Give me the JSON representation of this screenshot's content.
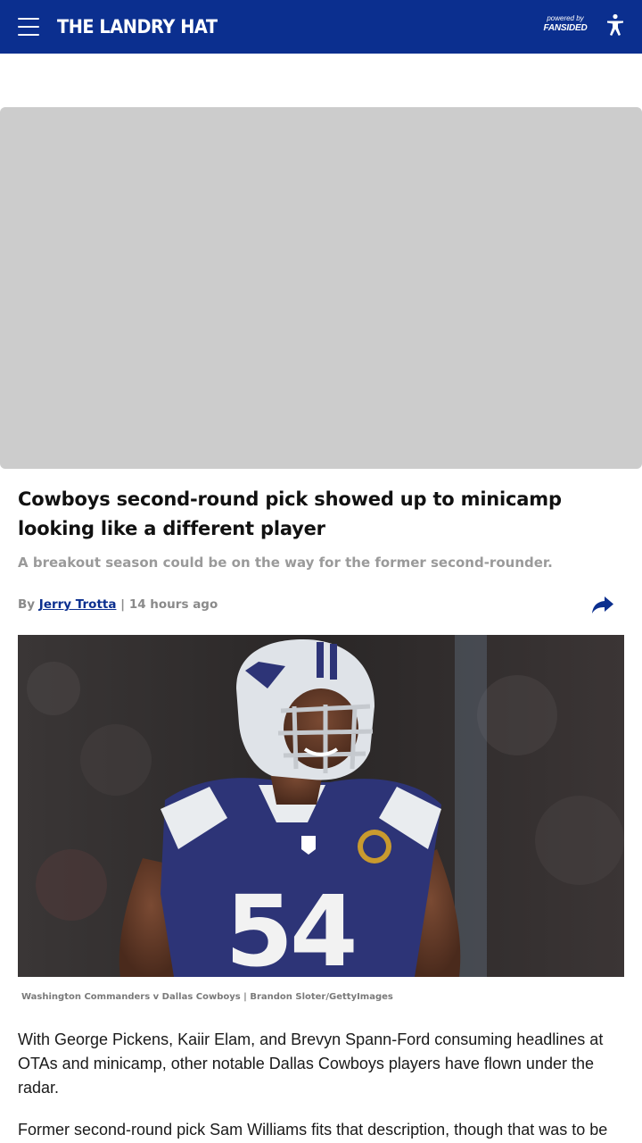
{
  "header": {
    "site_name": "THE LANDRY HAT",
    "powered_by": "powered by",
    "network": "FANSIDED",
    "bg_color": "#0b2f8f"
  },
  "icons": {
    "menu": "hamburger-menu-icon",
    "accessibility": "accessibility-icon",
    "share": "share-arrow-icon"
  },
  "article": {
    "headline": "Cowboys second-round pick showed up to minicamp looking like a different player",
    "dek": "A breakout season could be on the way for the former second-rounder.",
    "byline_prefix": "By",
    "author": "Jerry Trotta",
    "byline_separator": "|",
    "timestamp": "14 hours ago",
    "caption": "Washington Commanders v Dallas Cowboys | Brandon Sloter/GettyImages",
    "paragraphs": [
      "With George Pickens, Kaiir Elam, and Brevyn Spann-Ford consuming headlines at OTAs and minicamp, other notable Dallas Cowboys players have flown under the radar.",
      "Former second-round pick Sam Williams fits that description, though that was to be"
    ]
  },
  "hero_image": {
    "jersey_number": "54",
    "helmet_logo": "star",
    "jersey_color": "#2d3477"
  }
}
